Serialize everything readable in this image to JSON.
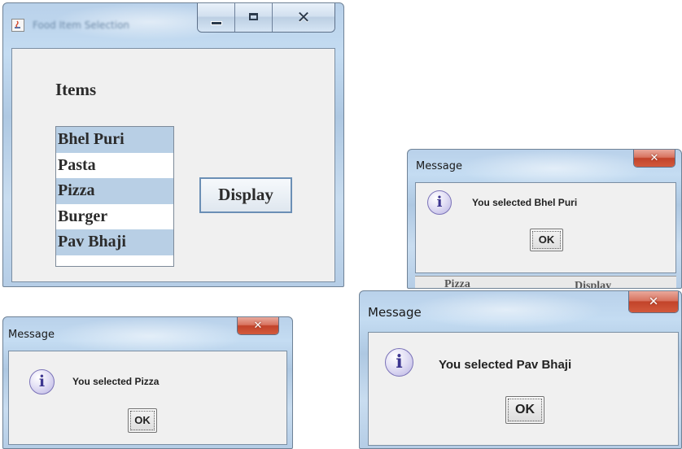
{
  "main_window": {
    "title": "Food Item Selection",
    "items_label": "Items",
    "list_items": [
      "Bhel Puri",
      "Pasta",
      "Pizza",
      "Burger",
      "Pav Bhaji"
    ],
    "display_button": "Display"
  },
  "dialog_bhel": {
    "title": "Message",
    "message": "You selected Bhel Puri",
    "ok": "OK",
    "background_fragments": [
      "Pizza",
      "Display"
    ]
  },
  "dialog_pizza": {
    "title": "Message",
    "message": "You selected Pizza",
    "ok": "OK"
  },
  "dialog_pav": {
    "title": "Message",
    "message": "You selected Pav Bhaji",
    "ok": "OK"
  },
  "icons": {
    "app": "java-cup-icon",
    "info": "information-icon",
    "close": "close-icon",
    "minimize": "minimize-icon",
    "maximize": "maximize-icon"
  },
  "colors": {
    "frame": "#b9d1ea",
    "client": "#f0f0f0",
    "selection": "#b8cfe5",
    "close_red": "#c2432a"
  }
}
